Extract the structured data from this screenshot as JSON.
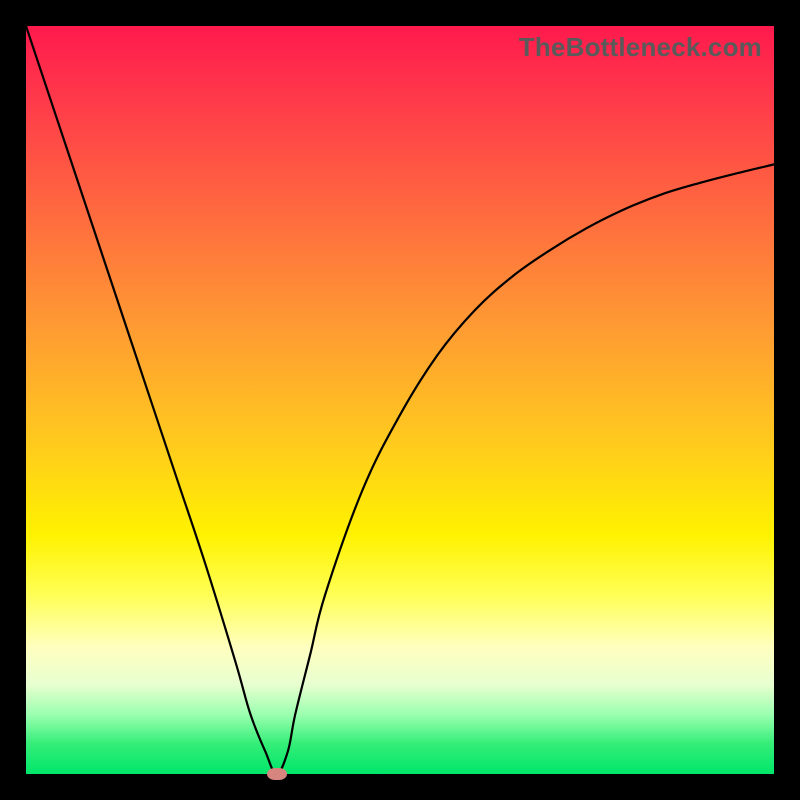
{
  "watermark": "TheBottleneck.com",
  "chart_data": {
    "type": "line",
    "title": "",
    "xlabel": "",
    "ylabel": "",
    "xlim": [
      0,
      100
    ],
    "ylim": [
      0,
      100
    ],
    "x": [
      0,
      4,
      8,
      12,
      16,
      20,
      24,
      28,
      30,
      32,
      33.5,
      35,
      36,
      38,
      40,
      45,
      50,
      55,
      60,
      65,
      70,
      75,
      80,
      85,
      90,
      95,
      100
    ],
    "y": [
      100,
      88,
      76,
      64,
      52,
      40,
      28,
      15,
      8,
      3,
      0,
      3,
      8,
      16,
      24,
      38,
      48,
      56,
      62,
      66.5,
      70,
      73,
      75.5,
      77.5,
      79,
      80.3,
      81.5
    ],
    "optimal_point": {
      "x": 33.5,
      "y": 0
    },
    "colors": {
      "top": "#ff1a4d",
      "middle": "#fff200",
      "bottom": "#00e66a",
      "curve": "#000000",
      "marker": "#d6867e"
    },
    "series": [
      {
        "name": "bottleneck-curve",
        "x_key": "x",
        "y_key": "y"
      }
    ]
  }
}
